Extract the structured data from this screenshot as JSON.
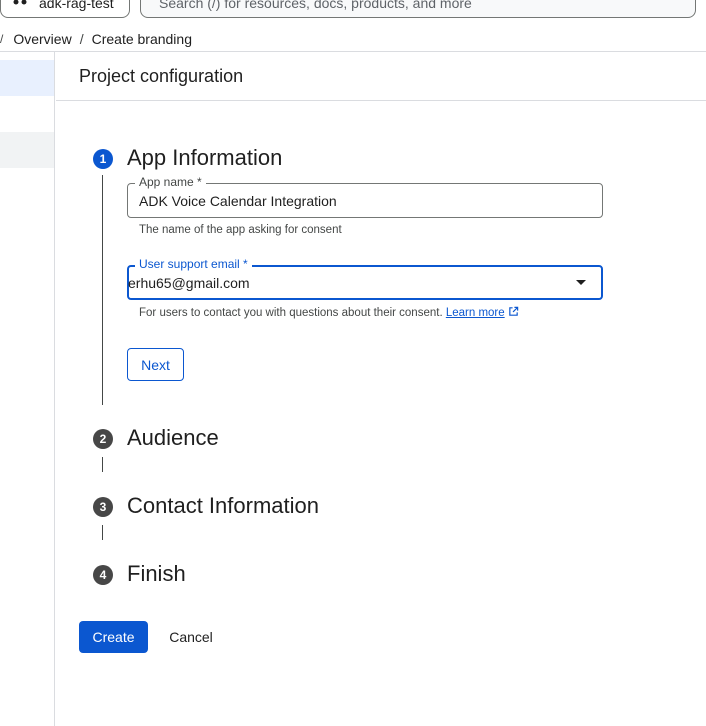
{
  "topbar": {
    "project_name": "adk-rag-test",
    "project_icon": "project-icon",
    "search_placeholder": "Search (/) for resources, docs, products, and more"
  },
  "breadcrumb": {
    "lead": "/",
    "items": [
      "Overview",
      "Create branding"
    ],
    "separator": "/"
  },
  "page": {
    "title": "Project configuration"
  },
  "stepper": {
    "steps": [
      {
        "number": "1",
        "title": "App Information",
        "state": "active"
      },
      {
        "number": "2",
        "title": "Audience",
        "state": "inactive"
      },
      {
        "number": "3",
        "title": "Contact Information",
        "state": "inactive"
      },
      {
        "number": "4",
        "title": "Finish",
        "state": "inactive"
      }
    ]
  },
  "app_info": {
    "app_name": {
      "label": "App name *",
      "value": "ADK Voice Calendar Integration",
      "hint": "The name of the app asking for consent"
    },
    "support_email": {
      "label": "User support email *",
      "value": "erhu65@gmail.com",
      "hint": "For users to contact you with questions about their consent.",
      "link_text": "Learn more"
    },
    "next_label": "Next"
  },
  "footer": {
    "create_label": "Create",
    "cancel_label": "Cancel"
  },
  "colors": {
    "primary": "#0b57d0",
    "text": "#1f1f1f",
    "border": "#747775",
    "step_inactive": "#474747"
  }
}
